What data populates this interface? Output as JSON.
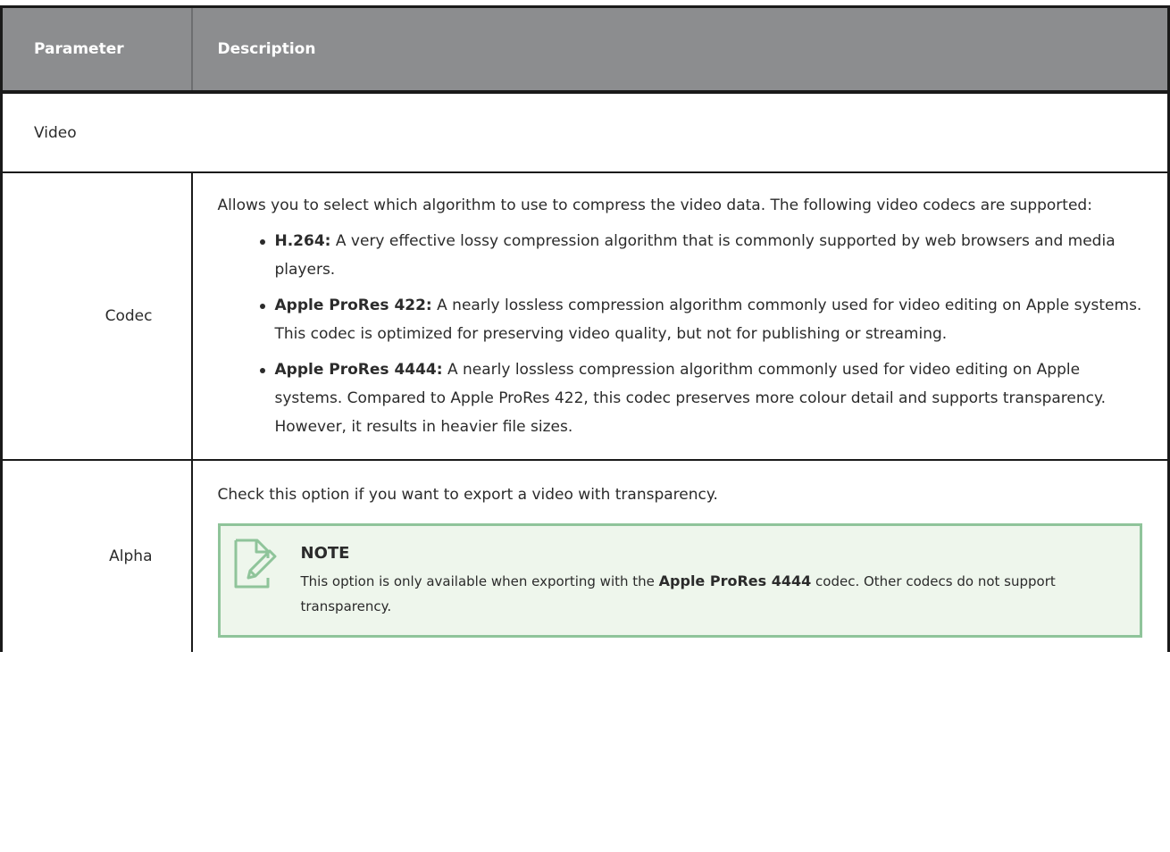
{
  "table": {
    "headers": {
      "parameter": "Parameter",
      "description": "Description"
    },
    "section_title": "Video",
    "rows": [
      {
        "parameter": "Codec",
        "description": "Allows you to select which algorithm to use to compress the video data. The following video codecs are supported:",
        "items": [
          {
            "term": "H.264:",
            "text": " A very effective lossy compression algorithm that is commonly supported by web browsers and media players."
          },
          {
            "term": "Apple ProRes 422:",
            "text": " A nearly lossless compression algorithm commonly used for video editing on Apple systems. This codec is optimized for preserving video quality, but not for publishing or streaming."
          },
          {
            "term": "Apple ProRes 4444:",
            "text": " A nearly lossless compression algorithm commonly used for video editing on Apple systems. Compared to Apple ProRes 422, this codec preserves more colour detail and supports transparency. However, it results in heavier file sizes."
          }
        ]
      },
      {
        "parameter": "Alpha",
        "description": "Check this option if you want to export a video with transparency.",
        "note": {
          "icon": "note-edit-icon",
          "title": "NOTE",
          "text_before": "This option is only available when exporting with the ",
          "bold": "Apple ProRes 4444",
          "text_after": " codec. Other codecs do not support transparency."
        }
      }
    ]
  },
  "colors": {
    "header_bg": "#8c8d8f",
    "note_bg": "#eef6ec",
    "note_border": "#8fc49a",
    "note_icon": "#8fc49a"
  }
}
